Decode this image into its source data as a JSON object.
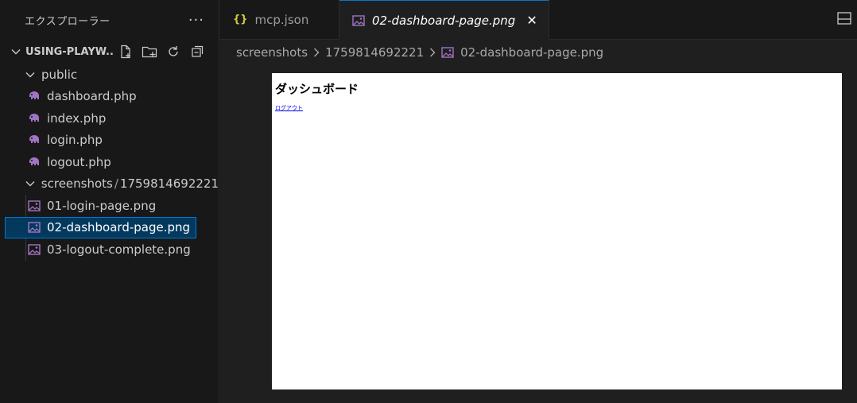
{
  "sidebar": {
    "title": "エクスプローラー",
    "more_label": "···",
    "root": {
      "label": "USING-PLAYW..."
    },
    "tree": [
      {
        "type": "folder",
        "label": "public",
        "expanded": true
      },
      {
        "type": "file",
        "icon": "php-elephant-icon",
        "label": "dashboard.php"
      },
      {
        "type": "file",
        "icon": "php-elephant-icon",
        "label": "index.php"
      },
      {
        "type": "file",
        "icon": "php-elephant-icon",
        "label": "login.php"
      },
      {
        "type": "file",
        "icon": "php-elephant-icon",
        "label": "logout.php"
      },
      {
        "type": "folder",
        "label": "screenshots",
        "sublabel": "1759814692221",
        "separator": "/",
        "expanded": true
      },
      {
        "type": "file",
        "icon": "image-file-icon",
        "label": "01-login-page.png"
      },
      {
        "type": "file",
        "icon": "image-file-icon",
        "label": "02-dashboard-page.png",
        "selected": true
      },
      {
        "type": "file",
        "icon": "image-file-icon",
        "label": "03-logout-complete.png"
      }
    ]
  },
  "editor": {
    "tabs": [
      {
        "label": "mcp.json",
        "icon": "json-braces-icon",
        "active": false,
        "icon_text": "{}"
      },
      {
        "label": "02-dashboard-page.png",
        "icon": "image-file-icon",
        "active": true,
        "close_label": "✕"
      }
    ],
    "breadcrumb": {
      "items": [
        "screenshots",
        "1759814692221",
        "02-dashboard-page.png"
      ]
    },
    "preview": {
      "heading": "ダッシュボード",
      "link": "ログアウト"
    }
  },
  "colors": {
    "accent": "#0078d4",
    "selection": "#04395e",
    "json_icon": "#cbcb41",
    "php_icon": "#a074c4",
    "image_icon": "#a074c4"
  }
}
